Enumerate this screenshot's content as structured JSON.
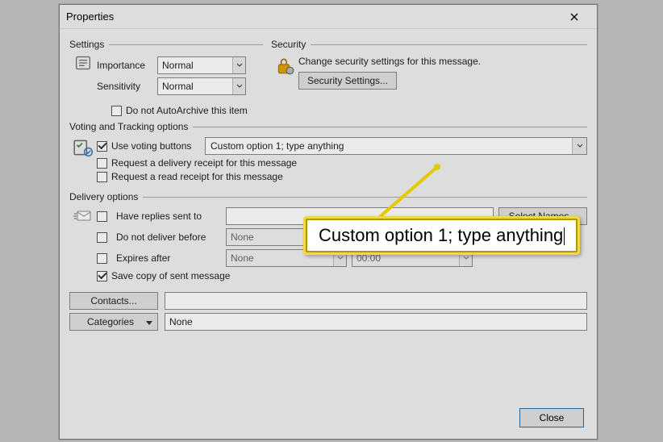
{
  "dialog": {
    "title": "Properties",
    "close_label": "Close"
  },
  "settings": {
    "section": "Settings",
    "importance_label": "Importance",
    "importance_value": "Normal",
    "sensitivity_label": "Sensitivity",
    "sensitivity_value": "Normal",
    "autoarchive_label": "Do not AutoArchive this item"
  },
  "security": {
    "section": "Security",
    "desc": "Change security settings for this message.",
    "button": "Security Settings..."
  },
  "voting": {
    "section": "Voting and Tracking options",
    "use_voting_label": "Use voting buttons",
    "voting_value": "Custom option 1; type anything",
    "delivery_receipt_label": "Request a delivery receipt for this message",
    "read_receipt_label": "Request a read receipt for this message"
  },
  "delivery": {
    "section": "Delivery options",
    "have_replies_label": "Have replies sent to",
    "select_names": "Select Names...",
    "dont_deliver_label": "Do not deliver before",
    "expires_label": "Expires after",
    "none": "None",
    "time": "00:00",
    "save_copy_label": "Save copy of sent message"
  },
  "footer": {
    "contacts_btn": "Contacts...",
    "categories_btn": "Categories",
    "categories_value": "None"
  },
  "callout": {
    "text": "Custom option 1; type anything"
  }
}
